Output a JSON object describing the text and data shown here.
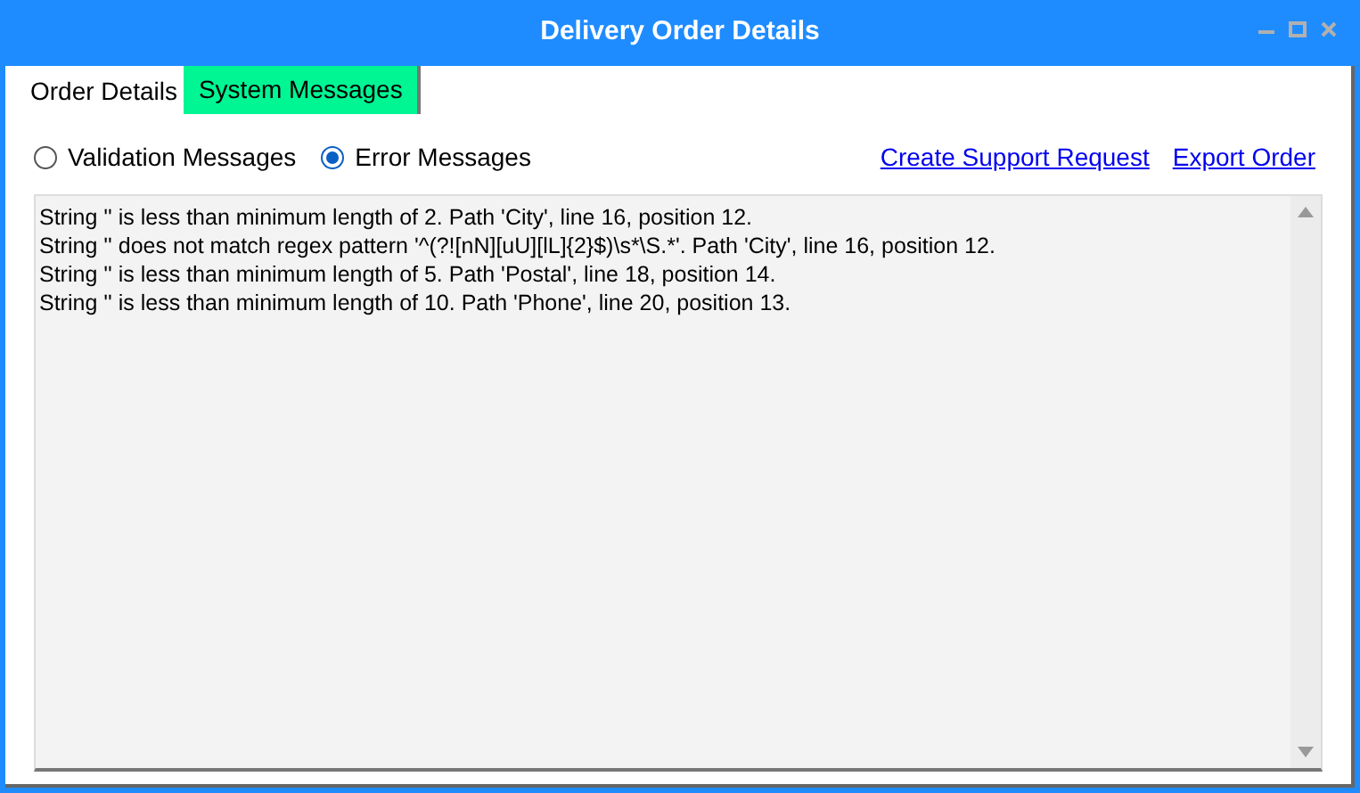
{
  "window": {
    "title": "Delivery Order Details"
  },
  "tabs": [
    {
      "label": "Order Details",
      "selected": false
    },
    {
      "label": "System Messages",
      "selected": true
    }
  ],
  "message_filter": [
    {
      "label": "Validation Messages",
      "selected": false
    },
    {
      "label": "Error Messages",
      "selected": true
    }
  ],
  "links": [
    "Create Support Request",
    "Export Order"
  ],
  "messages": [
    "String '' is less than minimum length of 2. Path 'City', line 16, position 12.",
    "String '' does not match regex pattern '^(?![nN][uU][lL]{2}$)\\s*\\S.*'. Path 'City', line 16, position 12.",
    "String '' is less than minimum length of 5. Path 'Postal', line 18, position 14.",
    "String '' is less than minimum length of 10. Path 'Phone', line 20, position 13."
  ]
}
